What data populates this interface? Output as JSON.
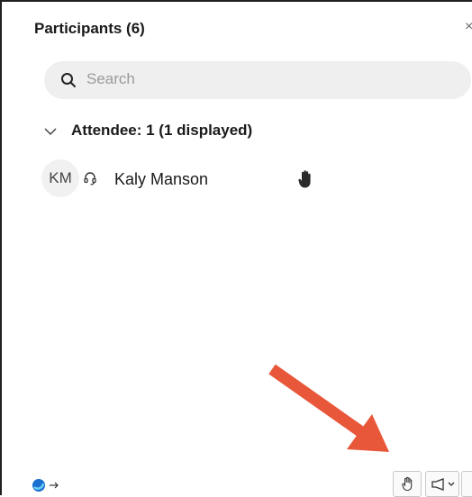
{
  "panel": {
    "title": "Participants (6)",
    "close_symbol": "×"
  },
  "search": {
    "placeholder": "Search",
    "icon": "search-icon"
  },
  "section": {
    "label": "Attendee: 1 (1 displayed)",
    "expanded": true,
    "icon": "chevron-down-icon"
  },
  "participants": [
    {
      "initials": "KM",
      "name": "Kaly Manson",
      "audio_icon": "headset-icon",
      "status_icon": "raised-hand-icon"
    }
  ],
  "toolbar": {
    "left_icon": "app-switch-icon",
    "buttons": [
      "raise-hand-icon",
      "megaphone-icon",
      "more-icon"
    ]
  },
  "colors": {
    "arrow": "#e8573a",
    "search_bg": "#efefef",
    "text": "#1a1a1a",
    "placeholder": "#9a9a9a"
  }
}
